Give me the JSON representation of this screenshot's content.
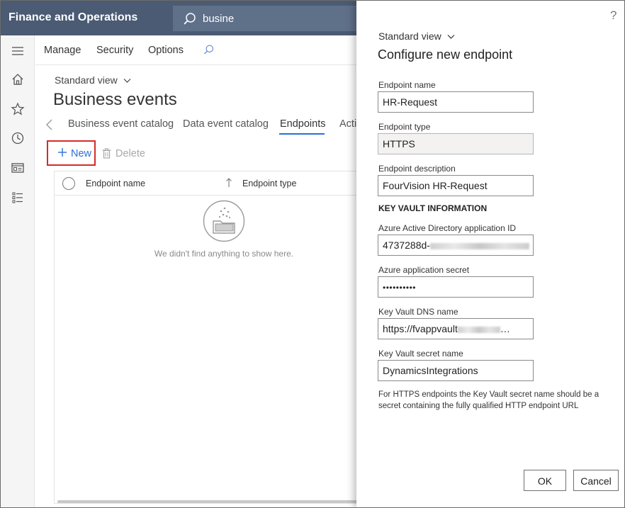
{
  "app": {
    "title": "Finance and Operations"
  },
  "search": {
    "value": "busine"
  },
  "action_pane": {
    "manage": "Manage",
    "security": "Security",
    "options": "Options"
  },
  "page": {
    "view": "Standard view",
    "title": "Business events",
    "tabs": [
      "Business event catalog",
      "Data event catalog",
      "Endpoints",
      "Acti"
    ],
    "active_tab": "Endpoints"
  },
  "toolbar": {
    "new_label": "New",
    "delete_label": "Delete"
  },
  "grid": {
    "columns": [
      "Endpoint name",
      "Endpoint type"
    ],
    "empty_message": "We didn't find anything to show here."
  },
  "panel": {
    "view": "Standard view",
    "title": "Configure new endpoint",
    "fields": {
      "endpoint_name": {
        "label": "Endpoint name",
        "value": "HR-Request"
      },
      "endpoint_type": {
        "label": "Endpoint type",
        "value": "HTTPS"
      },
      "endpoint_description": {
        "label": "Endpoint description",
        "value": "FourVision HR-Request"
      },
      "section": "KEY VAULT INFORMATION",
      "aad_app_id": {
        "label": "Azure Active Directory application ID",
        "value": "4737288d-"
      },
      "app_secret": {
        "label": "Azure application secret",
        "value": "••••••••••"
      },
      "kv_dns": {
        "label": "Key Vault DNS name",
        "value": "https://fvappvault"
      },
      "kv_secret": {
        "label": "Key Vault secret name",
        "value": "DynamicsIntegrations"
      }
    },
    "help_note": "For HTTPS endpoints the Key Vault secret name should be a secret containing the fully qualified HTTP endpoint URL",
    "ok_label": "OK",
    "cancel_label": "Cancel",
    "help_icon": "?"
  },
  "colors": {
    "topbar": "#4a5b73",
    "accent": "#2a6fd6",
    "highlight_box": "#d42b2b"
  }
}
